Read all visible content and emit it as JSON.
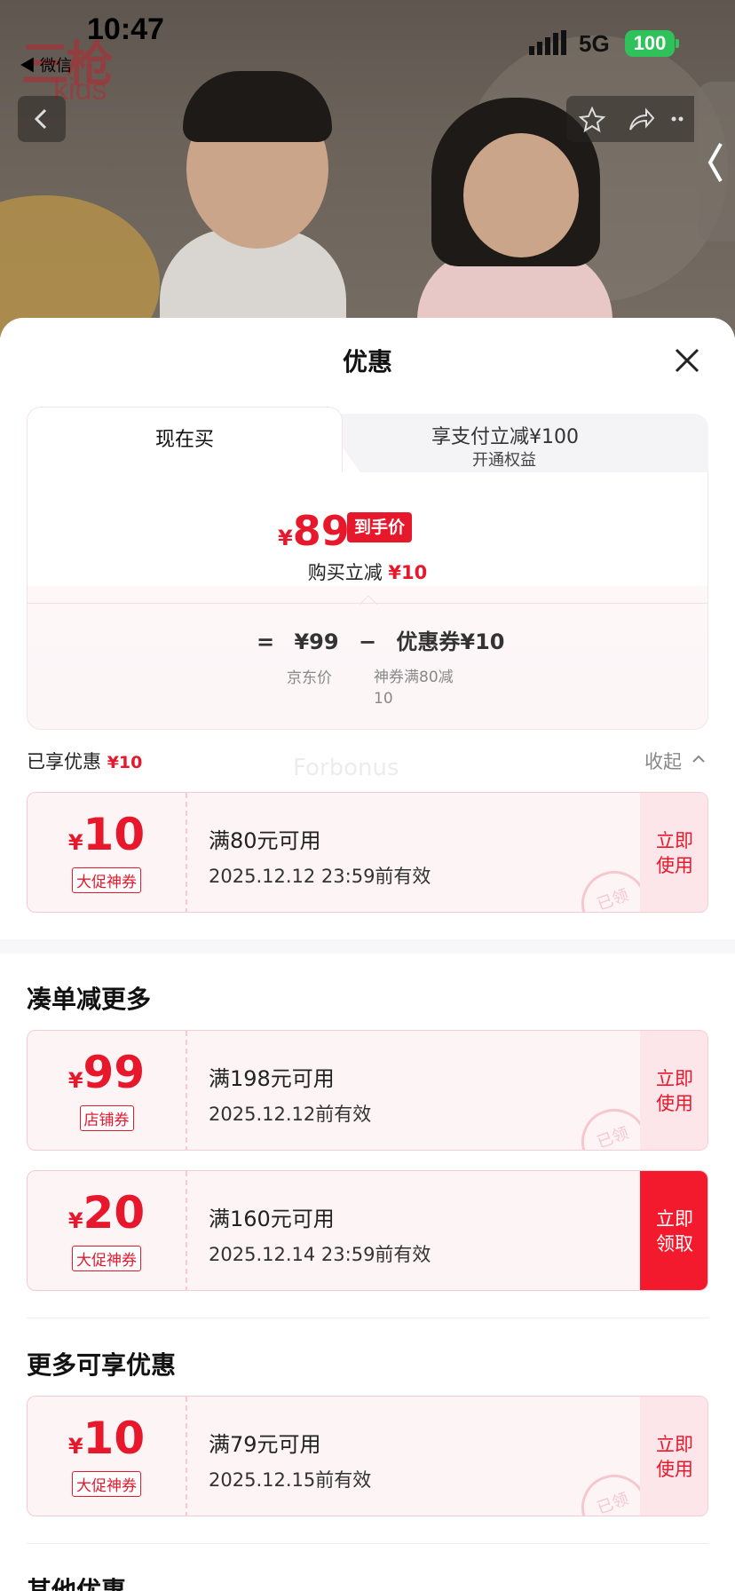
{
  "status_bar": {
    "time": "10:47",
    "back_app": "◀ 微信",
    "network": "5G",
    "battery": "100"
  },
  "hero": {
    "logo_text": "三枪",
    "logo_sub": "kids"
  },
  "sheet": {
    "title": "优惠",
    "tabs": {
      "now": "现在买",
      "other_line1": "享支付立减¥100",
      "other_line2": "开通权益"
    },
    "price": {
      "currency": "¥",
      "final": "89",
      "badge": "到手价",
      "sub_label": "购买立减",
      "sub_value": "¥10",
      "formula_eq": "=",
      "formula_jd_price": "¥99",
      "formula_minus": "−",
      "formula_coupon": "优惠券¥10",
      "jd_label": "京东价",
      "coupon_label": "神券满80减10"
    },
    "enjoyed": {
      "label": "已享优惠",
      "value": "¥10",
      "collapse": "收起",
      "watermark": "Forbonus"
    },
    "coupons_enjoyed": [
      {
        "currency": "¥",
        "amount": "10",
        "tag": "大促神券",
        "condition": "满80元可用",
        "valid": "2025.12.12 23:59前有效",
        "action": "立即使用",
        "stamp": "已领"
      }
    ],
    "section_more": "凑单减更多",
    "coupons_more": [
      {
        "currency": "¥",
        "amount": "99",
        "tag": "店铺券",
        "condition": "满198元可用",
        "valid": "2025.12.12前有效",
        "action": "立即使用",
        "stamp": "已领"
      },
      {
        "currency": "¥",
        "amount": "20",
        "tag": "大促神券",
        "condition": "满160元可用",
        "valid": "2025.12.14 23:59前有效",
        "action": "立即领取"
      }
    ],
    "section_extra": "更多可享优惠",
    "coupons_extra": [
      {
        "currency": "¥",
        "amount": "10",
        "tag": "大促神券",
        "condition": "满79元可用",
        "valid": "2025.12.15前有效",
        "action": "立即使用",
        "stamp": "已领"
      }
    ],
    "section_other": "其他优惠"
  },
  "colors": {
    "accent": "#e8182c",
    "coupon_bg": "#fcf4f5",
    "battery": "#30c25a"
  },
  "icons": [
    "back-chevron-icon",
    "star-icon",
    "share-icon",
    "more-icon",
    "close-icon",
    "chevron-up-icon",
    "signal-icon"
  ]
}
